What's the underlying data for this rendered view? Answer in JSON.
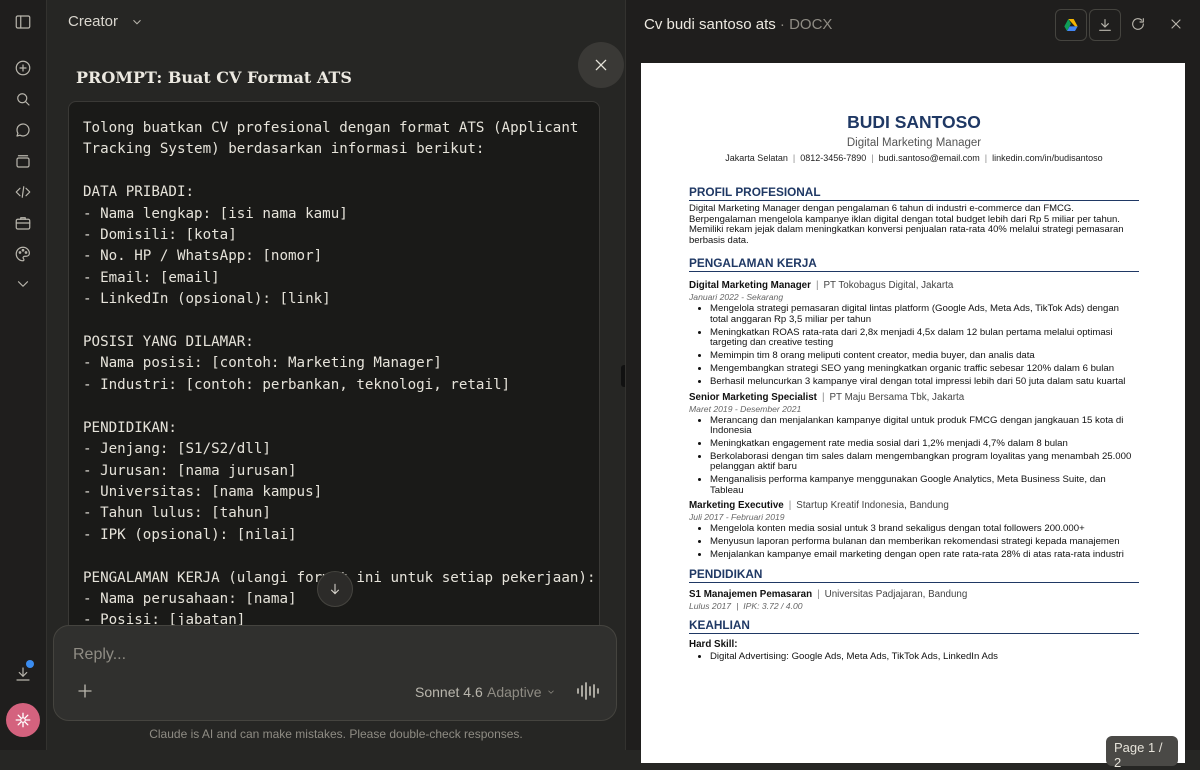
{
  "sidebar": {
    "icons": [
      "sidebar-toggle-icon",
      "new-chat-icon",
      "search-icon",
      "chats-icon",
      "projects-icon",
      "code-icon",
      "artifacts-icon",
      "customize-icon",
      "more-chevron-icon",
      "download-icon"
    ]
  },
  "chat": {
    "project_title": "Creator",
    "prompt_title": "PROMPT: Buat CV Format ATS",
    "prompt_text": "Tolong buatkan CV profesional dengan format ATS (Applicant\nTracking System) berdasarkan informasi berikut:\n\nDATA PRIBADI:\n- Nama lengkap: [isi nama kamu]\n- Domisili: [kota]\n- No. HP / WhatsApp: [nomor]\n- Email: [email]\n- LinkedIn (opsional): [link]\n\nPOSISI YANG DILAMAR:\n- Nama posisi: [contoh: Marketing Manager]\n- Industri: [contoh: perbankan, teknologi, retail]\n\nPENDIDIKAN:\n- Jenjang: [S1/S2/dll]\n- Jurusan: [nama jurusan]\n- Universitas: [nama kampus]\n- Tahun lulus: [tahun]\n- IPK (opsional): [nilai]\n\nPENGALAMAN KERJA (ulangi format ini untuk setiap pekerjaan):\n- Nama perusahaan: [nama]\n- Posisi: [jabatan]",
    "composer_placeholder": "Reply...",
    "model": "Sonnet 4.6",
    "mode": "Adaptive",
    "disclaimer": "Claude is AI and can make mistakes. Please double-check responses."
  },
  "document": {
    "title": "Cv budi santoso ats",
    "type": "DOCX",
    "page_indicator": "Page 1 / 2",
    "cv": {
      "name": "BUDI SANTOSO",
      "role": "Digital Marketing Manager",
      "contact": [
        "Jakarta Selatan",
        "0812-3456-7890",
        "budi.santoso@email.com",
        "linkedin.com/in/budisantoso"
      ],
      "profile_heading": "PROFIL PROFESIONAL",
      "profile_text": "Digital Marketing Manager dengan pengalaman 6 tahun di industri e-commerce dan FMCG. Berpengalaman mengelola kampanye iklan digital dengan total budget lebih dari Rp 5 miliar per tahun. Memiliki rekam jejak dalam meningkatkan konversi penjualan rata-rata 40% melalui strategi pemasaran berbasis data.",
      "experience_heading": "PENGALAMAN KERJA",
      "jobs": [
        {
          "position": "Digital Marketing Manager",
          "company": "PT Tokobagus Digital, Jakarta",
          "dates": "Januari 2022 - Sekarang",
          "bullets": [
            "Mengelola strategi pemasaran digital lintas platform (Google Ads, Meta Ads, TikTok Ads) dengan total anggaran Rp 3,5 miliar per tahun",
            "Meningkatkan ROAS rata-rata dari 2,8x menjadi 4,5x dalam 12 bulan pertama melalui optimasi targeting dan creative testing",
            "Memimpin tim 8 orang meliputi content creator, media buyer, dan analis data",
            "Mengembangkan strategi SEO yang meningkatkan organic traffic sebesar 120% dalam 6 bulan",
            "Berhasil meluncurkan 3 kampanye viral dengan total impressi lebih dari 50 juta dalam satu kuartal"
          ]
        },
        {
          "position": "Senior Marketing Specialist",
          "company": "PT Maju Bersama Tbk, Jakarta",
          "dates": "Maret 2019 - Desember 2021",
          "bullets": [
            "Merancang dan menjalankan kampanye digital untuk produk FMCG dengan jangkauan 15 kota di Indonesia",
            "Meningkatkan engagement rate media sosial dari 1,2% menjadi 4,7% dalam 8 bulan",
            "Berkolaborasi dengan tim sales dalam mengembangkan program loyalitas yang menambah 25.000 pelanggan aktif baru",
            "Menganalisis performa kampanye menggunakan Google Analytics, Meta Business Suite, dan Tableau"
          ]
        },
        {
          "position": "Marketing Executive",
          "company": "Startup Kreatif Indonesia, Bandung",
          "dates": "Juli 2017 - Februari 2019",
          "bullets": [
            "Mengelola konten media sosial untuk 3 brand sekaligus dengan total followers 200.000+",
            "Menyusun laporan performa bulanan dan memberikan rekomendasi strategi kepada manajemen",
            "Menjalankan kampanye email marketing dengan open rate rata-rata 28% di atas rata-rata industri"
          ]
        }
      ],
      "education_heading": "PENDIDIKAN",
      "education": {
        "degree": "S1 Manajemen Pemasaran",
        "school": "Universitas Padjajaran, Bandung",
        "graduated": "Lulus 2017",
        "gpa": "IPK: 3.72 / 4.00"
      },
      "skills_heading": "KEAHLIAN",
      "skills_label": "Hard Skill:",
      "skills_bullets": [
        "Digital Advertising: Google Ads, Meta Ads, TikTok Ads, LinkedIn Ads"
      ]
    }
  },
  "colors": {
    "app_bg": "#262624",
    "sidebar_bg": "#1f1e1d",
    "cv_heading": "#1f3864",
    "avatar": "#d4627e",
    "notification_dot": "#3a8cf0"
  }
}
